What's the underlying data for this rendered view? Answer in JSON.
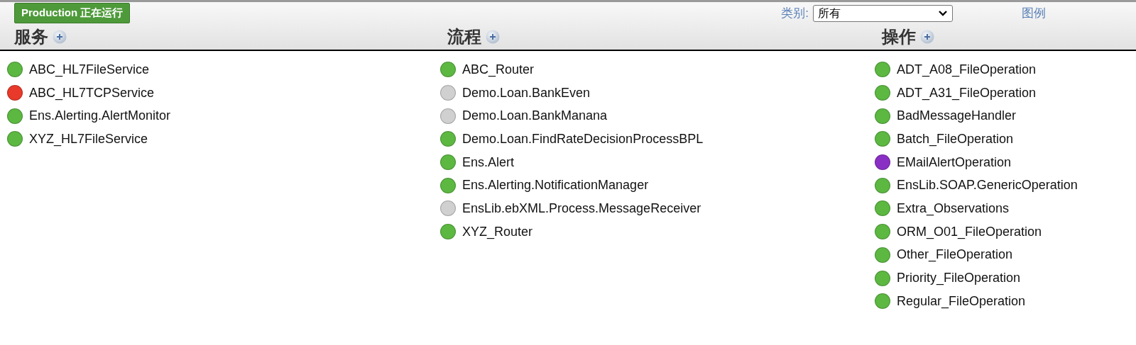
{
  "status_badge": "Production 正在运行",
  "filter": {
    "label": "类别:",
    "value": "所有"
  },
  "legend_link": "图例",
  "columns": [
    {
      "title": "服务",
      "items": [
        {
          "name": "ABC_HL7FileService",
          "color": "#5cb841"
        },
        {
          "name": "ABC_HL7TCPService",
          "color": "#e8392a"
        },
        {
          "name": "Ens.Alerting.AlertMonitor",
          "color": "#5cb841"
        },
        {
          "name": "XYZ_HL7FileService",
          "color": "#5cb841"
        }
      ]
    },
    {
      "title": "流程",
      "items": [
        {
          "name": "ABC_Router",
          "color": "#5cb841"
        },
        {
          "name": "Demo.Loan.BankEven",
          "color": "#d0d0d0"
        },
        {
          "name": "Demo.Loan.BankManana",
          "color": "#d0d0d0"
        },
        {
          "name": "Demo.Loan.FindRateDecisionProcessBPL",
          "color": "#5cb841"
        },
        {
          "name": "Ens.Alert",
          "color": "#5cb841"
        },
        {
          "name": "Ens.Alerting.NotificationManager",
          "color": "#5cb841"
        },
        {
          "name": "EnsLib.ebXML.Process.MessageReceiver",
          "color": "#d0d0d0"
        },
        {
          "name": "XYZ_Router",
          "color": "#5cb841"
        }
      ]
    },
    {
      "title": "操作",
      "items": [
        {
          "name": "ADT_A08_FileOperation",
          "color": "#5cb841"
        },
        {
          "name": "ADT_A31_FileOperation",
          "color": "#5cb841"
        },
        {
          "name": "BadMessageHandler",
          "color": "#5cb841"
        },
        {
          "name": "Batch_FileOperation",
          "color": "#5cb841"
        },
        {
          "name": "EMailAlertOperation",
          "color": "#8a2fc4"
        },
        {
          "name": "EnsLib.SOAP.GenericOperation",
          "color": "#5cb841"
        },
        {
          "name": "Extra_Observations",
          "color": "#5cb841"
        },
        {
          "name": "ORM_O01_FileOperation",
          "color": "#5cb841"
        },
        {
          "name": "Other_FileOperation",
          "color": "#5cb841"
        },
        {
          "name": "Priority_FileOperation",
          "color": "#5cb841"
        },
        {
          "name": "Regular_FileOperation",
          "color": "#5cb841"
        }
      ]
    }
  ]
}
